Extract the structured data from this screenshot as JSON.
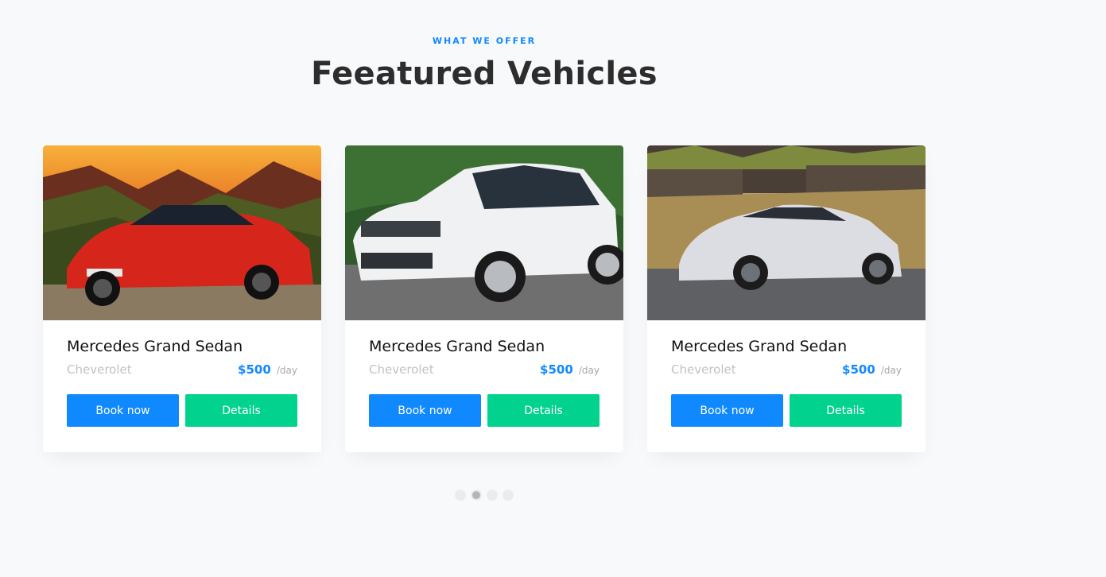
{
  "section": {
    "subheading": "WHAT WE OFFER",
    "heading": "Feeatured Vehicles"
  },
  "vehicles": [
    {
      "image": "red-convertible-photo",
      "name": "Mercedes Grand Sedan",
      "brand": "Cheverolet",
      "price": "$500",
      "per": "/day",
      "book_label": "Book now",
      "details_label": "Details"
    },
    {
      "image": "white-suv-photo",
      "name": "Mercedes Grand Sedan",
      "brand": "Cheverolet",
      "price": "$500",
      "per": "/day",
      "book_label": "Book now",
      "details_label": "Details"
    },
    {
      "image": "silver-sports-car-photo",
      "name": "Mercedes Grand Sedan",
      "brand": "Cheverolet",
      "price": "$500",
      "per": "/day",
      "book_label": "Book now",
      "details_label": "Details"
    }
  ],
  "carousel": {
    "dot_count": 4,
    "active_index": 1
  },
  "colors": {
    "accent": "#1089ff",
    "details_button": "#01d28e",
    "background": "#f8f9fb"
  }
}
